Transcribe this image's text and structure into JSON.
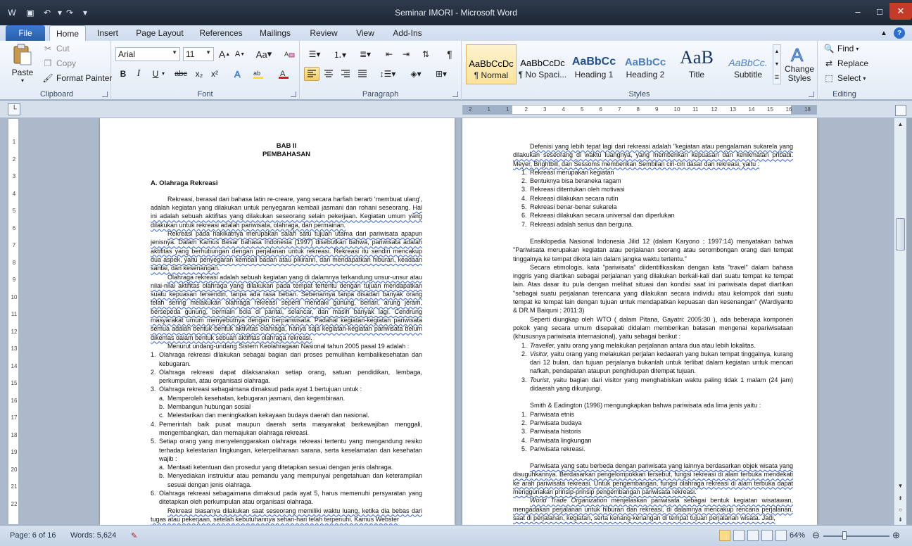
{
  "window": {
    "title": "Seminar IMORI  -  Microsoft Word",
    "quick_access": [
      "save-icon",
      "undo-icon",
      "redo-icon",
      "customize-icon"
    ],
    "controls": {
      "minimize": "–",
      "maximize": "□",
      "close": "✕"
    }
  },
  "ribbon": {
    "file_tab": "File",
    "tabs": [
      "Home",
      "Insert",
      "Page Layout",
      "References",
      "Mailings",
      "Review",
      "View",
      "Add-Ins"
    ],
    "active_tab": "Home",
    "clipboard": {
      "label": "Clipboard",
      "paste": "Paste",
      "cut": "Cut",
      "copy": "Copy",
      "format_painter": "Format Painter"
    },
    "font": {
      "label": "Font",
      "font_name": "Arial",
      "font_size": "11",
      "bold": "B",
      "italic": "I",
      "underline": "U",
      "strike": "abc",
      "subscript": "x₂",
      "superscript": "x²",
      "grow": "A",
      "shrink": "A",
      "case": "Aa"
    },
    "paragraph": {
      "label": "Paragraph"
    },
    "styles": {
      "label": "Styles",
      "items": [
        {
          "sample": "AaBbCcDc",
          "name": "¶ Normal"
        },
        {
          "sample": "AaBbCcDc",
          "name": "¶ No Spaci..."
        },
        {
          "sample": "AaBbCc",
          "name": "Heading 1"
        },
        {
          "sample": "AaBbCc",
          "name": "Heading 2"
        },
        {
          "sample": "AaB",
          "name": "Title"
        },
        {
          "sample": "AaBbCc.",
          "name": "Subtitle"
        }
      ],
      "change_styles": "Change Styles"
    },
    "editing": {
      "label": "Editing",
      "find": "Find",
      "replace": "Replace",
      "select": "Select"
    }
  },
  "ruler": {
    "ticks": [
      "2",
      "1",
      "1",
      "2",
      "3",
      "4",
      "5",
      "6",
      "7",
      "8",
      "9",
      "10",
      "11",
      "12",
      "13",
      "14",
      "15",
      "16",
      "18"
    ]
  },
  "vruler": {
    "ticks": [
      "1",
      "2",
      "3",
      "4",
      "5",
      "6",
      "7",
      "8",
      "9",
      "10",
      "11",
      "12",
      "13",
      "14",
      "15",
      "16",
      "17",
      "18",
      "19",
      "20",
      "21",
      "22"
    ]
  },
  "page_left": {
    "chapter": "BAB II",
    "chapter_title": "PEMBAHASAN",
    "section": "A. Olahraga Rekreasi",
    "p1": "Rekreasi, berasal dari bahasa latin re-creare, yang secara harfiah berarti 'membuat ulang', adalah kegiatan yang dilakukan untuk penyegaran kembali jasmani dan rohani seseorang.",
    "p1b": "Hal ini adalah sebuah aktifitas yang dilakukan seseorang selain pekerjaan. Kegiatan umum yang dilakukan untuk rekreasi adalah pariwisata, olahraga,  dan permainan.",
    "p2": "Rekreasi pada hakikatnya merupakan salah satu tujuan utama dari pariwisata apapun jenisnya. Dalam Kamus Besar bahasa Indonesia (1997) disebutkan bahwa, pariwisata adalah aktifitas yang berhubungan  dengan perjalanan untuk rekreasi. Rekreasi itu sendiri mencakup dua aspek, yaitu penyegaran kembali badan atau pikirann, dan mendapatkan hiburan, keadaan santai, dan kesenangan.",
    "p3": "Olahraga rekreasi adalah sebuah kegiatan yang di dalamnya terkandung unsur-unsur atau nilai-nilai aktifitas olahraga yang dilakukan pada tempat tertentu dengan tujuan mendapatkan suatu kepuasan tersendiri, tanpa ada rasa beban. Sebenarnya tanpa disadari banyak orang telah sering melakukan olahraga rekreasi seperti mendaki gunung, berlari, arung jeram, bersepeda gunung, bermain bola di pantai, selancar, dan masih banyak lagi. Cendrung masyarakat umum menyebutnya dengan berpariwisata. Padahal kegiatan-kegiatan pariwisata semua adalah bentuk-bentuk aktivitas olahraga, hanya saja kegiatan-kegiatan pariwisata belum dikemas dalam bentuk sebuah aktifitas olahraga rekreasi.",
    "p4": "Menurut undang-undang  Sistem Keolahragaan  Nasional tahun 2005  pasal 19 adalah :",
    "list": [
      {
        "n": "1.",
        "t": "Olahraga rekreasi dilakukan sebagai bagian dari proses pemulihan kembalikesehatan dan kebugaran."
      },
      {
        "n": "2.",
        "t": "Olahraga rekreasi dapat dilaksanakan setiap orang, satuan pendidikan, lembaga, perkumpulan, atau organisasi olahraga."
      },
      {
        "n": "3.",
        "t": "Olahraga rekreasi sebagaimana dimaksud pada ayat 1 bertujuan  untuk :"
      }
    ],
    "sub3": [
      {
        "n": "a.",
        "t": "Memperoleh kesehatan, kebugaran jasmani, dan kegembiraan."
      },
      {
        "n": "b.",
        "t": "Membangun hubungan  sosial"
      },
      {
        "n": "c.",
        "t": "Melestarikan dan meningkatkan kekayaan budaya daerah dan nasional."
      }
    ],
    "list2": [
      {
        "n": "4.",
        "t": "Pemerintah baik pusat maupun daerah serta masyarakat berkewajiban menggali, mengembangkan, dan memajukan olahraga  rekreasi."
      },
      {
        "n": "5.",
        "t": "Setiap orang yang menyelenggarakan olahraga rekreasi tertentu yang mengandung resiko terhadap kelestarian lingkungan, keterpeliharaan sarana, serta keselamatan dan kesehatan wajib :"
      }
    ],
    "sub5": [
      {
        "n": "a.",
        "t": "Mentaati ketentuan dan prosedur yang ditetapkan sesuai dengan jenis olahraga."
      },
      {
        "n": "b.",
        "t": "Menyediakan instruktur atau pemandu yang mempunyai pengetahuan dan keterampilan sesuai dengan jenis olahraga."
      }
    ],
    "list3": [
      {
        "n": "6.",
        "t": "Olahraga rekreasi sebagaimana dimaksud pada ayat 5, harus memenuhi persyaratan yang ditetapkan oleh perkumpulan atau organisasi olahraga."
      }
    ],
    "p5": "Rekreasi biasanya dilakukan saat seseorang memiliki waktu luang, ketika dia bebas dari tugas atau pekerjaan, setelah kebutuhannya sehari-hari telah terpenuhi. Kamus Webster"
  },
  "page_right": {
    "p1": "Defenisi yang lebih tepat lagi dari rekreasi adalah \"kegiatan atau pengalaman sukarela yang dilakukan seseorang di waktu luangnya, yang memberikan kepuasan dan kenikmatan pribadi. Meyer, Brightbill, dan Sessoms memberikan Sembilan ciri-ciri dasar dari rekreasi, yaitu :",
    "list1": [
      {
        "n": "1.",
        "t": "Rekreasi merupakan kegiatan"
      },
      {
        "n": "2.",
        "t": "Bentuknya bisa beraneka ragam"
      },
      {
        "n": "3.",
        "t": "Rekreasi ditentukan oleh motivasi"
      },
      {
        "n": "4.",
        "t": "Rekreasi dilakukan secara rutin"
      },
      {
        "n": "5.",
        "t": "Rekreasi benar-benar  sukarela"
      },
      {
        "n": "6.",
        "t": "Rekreasi dilakukan secara universal dan diperlukan"
      },
      {
        "n": "7.",
        "t": "Rekreasi adalah  serius dan berguna."
      }
    ],
    "p2": "Ensiklopedia Nasional Indonesia Jilid 12 (dalam Karyono ; 1997:14) menyatakan bahwa \"Pariwisata merupakan kegiatan atau perjalanan seorang atau serombongan orang dari tempat tinggalnya ke tempat dikota lain dalam jangka waktu tertentu.\"",
    "p3": "Secara etimologis, kata \"pariwisata\" diidentifikasikan dengan kata \"travel\" dalam bahasa inggris yang diartikan sebagai perjalanan yang dilakukan berkali-kali dari suatu tempat ke tempat lain. Atas dasar itu pula dengan melihat situasi dan kondisi saat ini pariwisata dapat diartikan \"sebagai suatu perjalanan terencana yang dilakukan secara individu atau kelompok dari suatu tempat ke tempat lain dengan tujuan untuk mendapatkan kepuasan dan kesenangan\" (Wardiyanto & DR.M Baiquni ; 2011:3)",
    "p4": "Seperti diungkap oleh WTO ( dalam Pitana, Gayatri: 2005:30 ), ada beberapa komponen pokok yang secara umum disepakati didalam memberikan batasan mengenai kepariwisataan (khususnya pariwisata internasional), yaitu sebagai berikut :",
    "list2": [
      {
        "n": "1.",
        "em": "Traveller,",
        "t": " yaitu orang yang melakukan perjalanan antara dua atau lebih lokalitas."
      },
      {
        "n": "2.",
        "em": "Visitor,",
        "t": " yaitu orang yang melakukan perjalan kedaerah yang bukan tempat  tinggalnya, kurang dari 12 bulan, dan tujuan perjalanya bukanlah untuk terlibat dalam kegiatan untuk mencari nafkah, pendapatan ataupun penghidupan  ditempat tujuan."
      },
      {
        "n": "3.",
        "em": "Tourist,",
        "t": " yaitu bagian dari visitor yang menghabiskan waktu paling tidak 1 malam (24 jam) didaerah yang dikunjungi."
      }
    ],
    "p5": "Smith & Eadington (1996) mengungkapkan bahwa pariwisata ada lima jenis yaitu :",
    "list3": [
      {
        "n": "1.",
        "t": "Pariwisata etnis"
      },
      {
        "n": "2.",
        "t": "Pariwisata budaya"
      },
      {
        "n": "3.",
        "t": "Pariwisata historis"
      },
      {
        "n": "4.",
        "t": "Pariwisata lingkungan"
      },
      {
        "n": "5.",
        "t": "Pariwisata rekreasi."
      }
    ],
    "p6": "Pariwisata yang satu berbeda dengan pariwisata yang lainnya berdasarkan objek wisata yang disuguhkannya. Berdasarkan pengelompokkan tersebut, fungsi rekreasi di alam terbuka mendekati ke arah pariwisata rekreasi. Untuk pengembangan, fungsi olahraga rekreasi di alam terbuka dapat menggunakan prinsip-prinsip pengembangan  pariwisata rekreasi.",
    "p7_em": "World Trade Organization",
    "p7": " menjelaskan pariwisata sebagai bentuk kegiatan wisatawan, mengadakan perjalanan untuk hiburan dan rekreasi, di dalamnya mencakup rencana perjalanan, saat di perjalanan,  kegiatan, serta kenang-kenangan di tempat tujuan perjalanan wisata. Jadi,"
  },
  "status": {
    "page": "Page: 6 of 16",
    "words": "Words: 5,624",
    "zoom": "64%"
  }
}
